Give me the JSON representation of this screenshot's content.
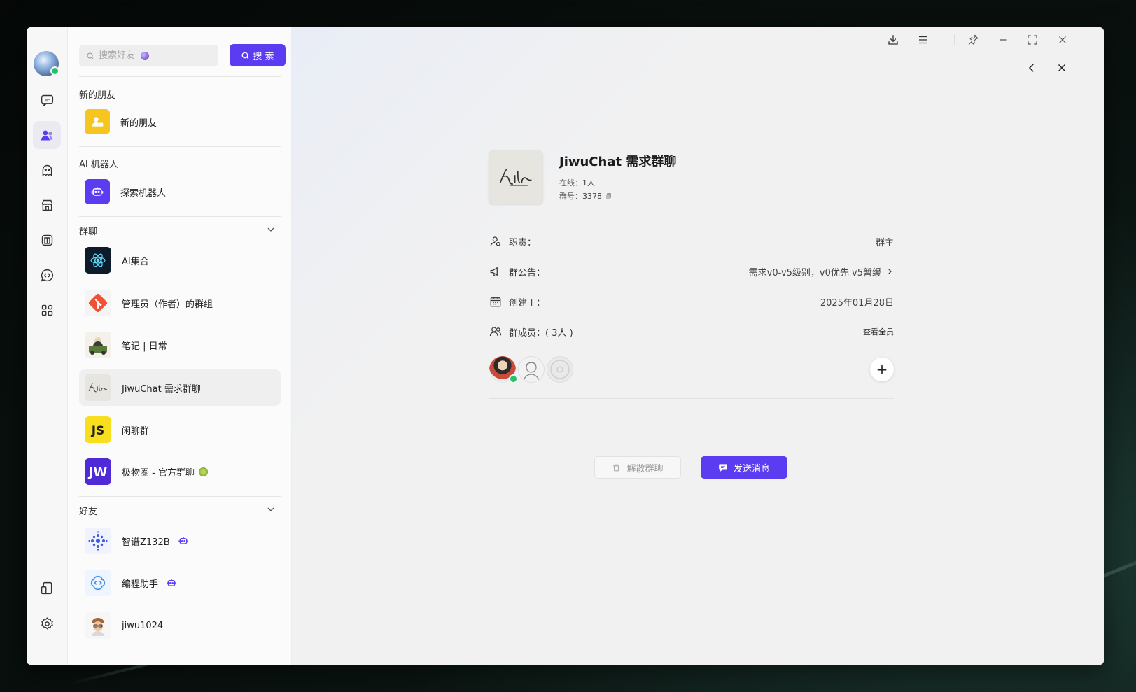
{
  "search": {
    "placeholder": "搜索好友",
    "button_label": "搜 索"
  },
  "sections": {
    "new_friends": {
      "title": "新的朋友",
      "item_label": "新的朋友"
    },
    "ai_bots": {
      "title": "AI 机器人",
      "item_label": "探索机器人"
    },
    "groups": {
      "title": "群聊",
      "items": [
        {
          "label": "AI集合"
        },
        {
          "label": "管理员（作者）的群组"
        },
        {
          "label": "笔记 | 日常"
        },
        {
          "label": "JiwuChat 需求群聊"
        },
        {
          "label": "闲聊群"
        },
        {
          "label": "极物圈 - 官方群聊"
        }
      ]
    },
    "friends": {
      "title": "好友",
      "items": [
        {
          "label": "智谱Z132B"
        },
        {
          "label": "编程助手"
        },
        {
          "label": "jiwu1024"
        }
      ]
    }
  },
  "group_detail": {
    "name": "JiwuChat 需求群聊",
    "avatar_text": "Kilr",
    "online_label": "在线：",
    "online_value": "1人",
    "number_label": "群号：",
    "number_value": "3378",
    "role_label": "职责：",
    "role_value": "群主",
    "notice_label": "群公告：",
    "notice_value": "需求v0-v5级别，v0优先 v5暂缓",
    "created_label": "创建于：",
    "created_value": "2025年01月28日",
    "members_label": "群成员：( 3人 )",
    "view_all_label": "查看全员",
    "dissolve_label": "解散群聊",
    "send_label": "发送消息"
  },
  "colors": {
    "accent": "#5b3cf0",
    "online": "#21c36b"
  }
}
